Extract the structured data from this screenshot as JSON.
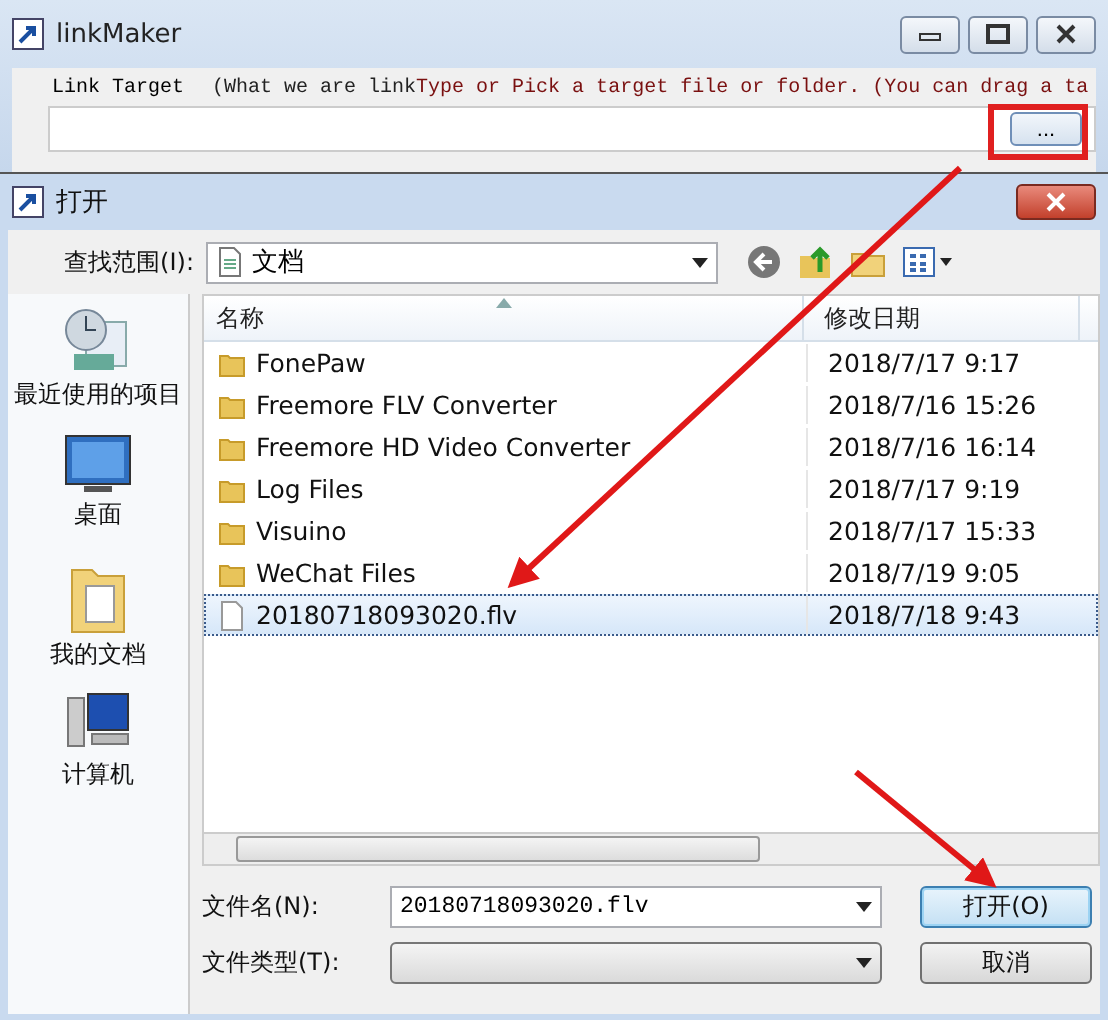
{
  "main_window": {
    "title": "linkMaker",
    "target_label": "Link Target",
    "target_hint_prefix": "(What we are link",
    "target_hint": "Type or Pick a target file or folder. (You can drag a ta",
    "browse_button": "..."
  },
  "dialog": {
    "title": "打开",
    "look_in_label": "查找范围(I):",
    "look_in_value": "文档",
    "places": [
      {
        "label": "最近使用的项目",
        "kind": "recent"
      },
      {
        "label": "桌面",
        "kind": "desktop"
      },
      {
        "label": "我的文档",
        "kind": "documents"
      },
      {
        "label": "计算机",
        "kind": "computer"
      }
    ],
    "columns": [
      "名称",
      "修改日期"
    ],
    "files": [
      {
        "name": "FonePaw",
        "modified": "2018/7/17 9:17",
        "kind": "folder",
        "selected": false
      },
      {
        "name": "Freemore FLV Converter",
        "modified": "2018/7/16 15:26",
        "kind": "folder",
        "selected": false
      },
      {
        "name": "Freemore HD Video Converter",
        "modified": "2018/7/16 16:14",
        "kind": "folder",
        "selected": false
      },
      {
        "name": "Log Files",
        "modified": "2018/7/17 9:19",
        "kind": "folder",
        "selected": false
      },
      {
        "name": "Visuino",
        "modified": "2018/7/17 15:33",
        "kind": "folder",
        "selected": false
      },
      {
        "name": "WeChat Files",
        "modified": "2018/7/19 9:05",
        "kind": "folder",
        "selected": false
      },
      {
        "name": "20180718093020.flv",
        "modified": "2018/7/18 9:43",
        "kind": "file",
        "selected": true
      }
    ],
    "file_name_label": "文件名(N):",
    "file_name_value": "20180718093020.flv",
    "file_type_label": "文件类型(T):",
    "buttons": [
      {
        "label": "打开(O)",
        "default": true
      },
      {
        "label": "取消",
        "default": false
      }
    ]
  }
}
